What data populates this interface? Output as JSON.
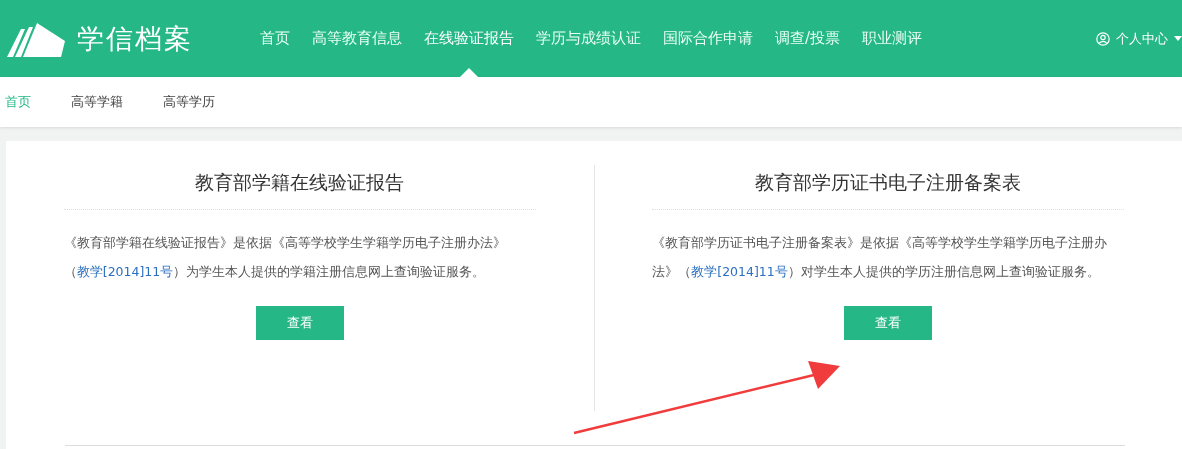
{
  "header": {
    "logo_text": "学信档案",
    "nav": [
      {
        "label": "首页",
        "selected": false
      },
      {
        "label": "高等教育信息",
        "selected": false
      },
      {
        "label": "在线验证报告",
        "selected": true
      },
      {
        "label": "学历与成绩认证",
        "selected": false
      },
      {
        "label": "国际合作申请",
        "selected": false
      },
      {
        "label": "调查/投票",
        "selected": false
      },
      {
        "label": "职业测评",
        "selected": false
      }
    ],
    "user_menu": "个人中心"
  },
  "breadcrumb_tabs": [
    {
      "label": "首页",
      "selected": true
    },
    {
      "label": "高等学籍",
      "selected": false
    },
    {
      "label": "高等学历",
      "selected": false
    }
  ],
  "cards": [
    {
      "title": "教育部学籍在线验证报告",
      "text_before": "《教育部学籍在线验证报告》是依据《高等学校学生学籍学历电子注册办法》（",
      "link": "教学[2014]11号",
      "text_after": "）为学生本人提供的学籍注册信息网上查询验证服务。",
      "button": "查看"
    },
    {
      "title": "教育部学历证书电子注册备案表",
      "text_before": "《教育部学历证书电子注册备案表》是依据《高等学校学生学籍学历电子注册办法》（",
      "link": "教学[2014]11号",
      "text_after": "）对学生本人提供的学历注册信息网上查询验证服务。",
      "button": "查看"
    }
  ]
}
